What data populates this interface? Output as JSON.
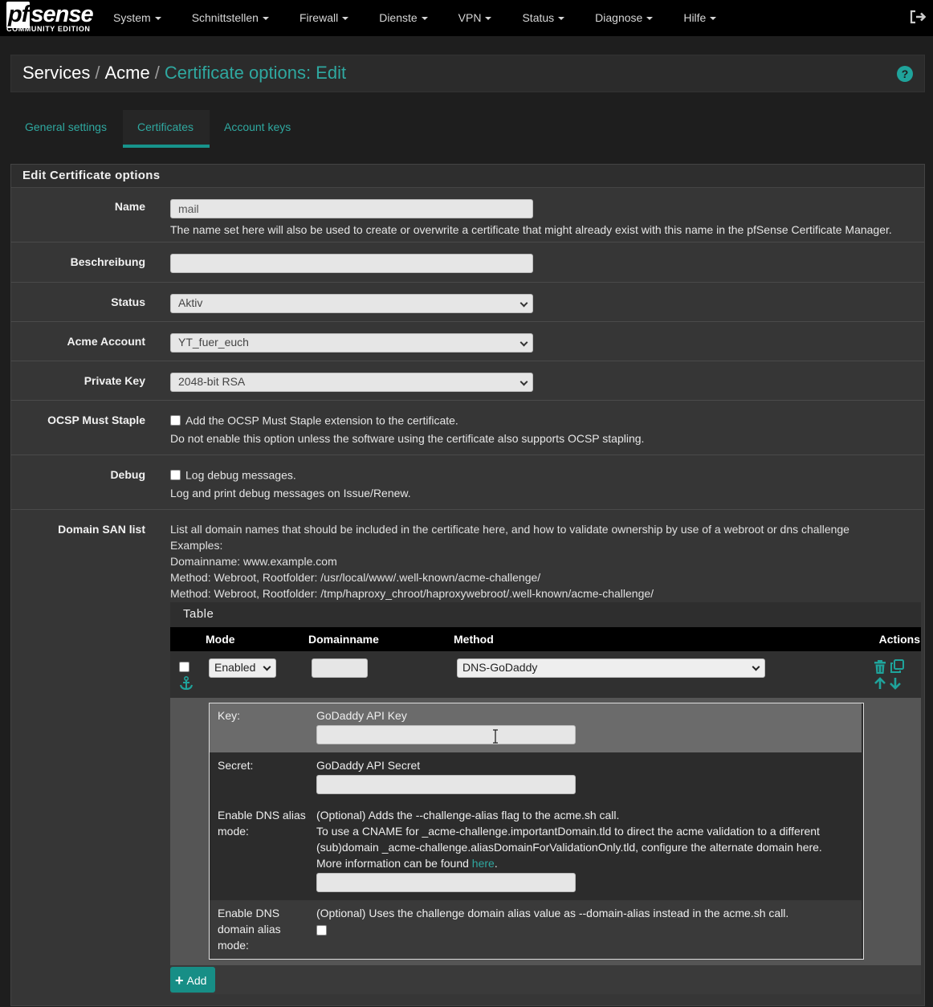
{
  "brand": {
    "logo_text": "pfsense",
    "edition": "COMMUNITY EDITION"
  },
  "nav": [
    {
      "label": "System"
    },
    {
      "label": "Schnittstellen"
    },
    {
      "label": "Firewall"
    },
    {
      "label": "Dienste"
    },
    {
      "label": "VPN"
    },
    {
      "label": "Status"
    },
    {
      "label": "Diagnose"
    },
    {
      "label": "Hilfe"
    }
  ],
  "breadcrumb": {
    "part1": "Services",
    "part2": "Acme",
    "current": "Certificate options: Edit",
    "separator": "/"
  },
  "tabs": [
    {
      "label": "General settings"
    },
    {
      "label": "Certificates"
    },
    {
      "label": "Account keys"
    }
  ],
  "panel": {
    "title": "Edit Certificate options"
  },
  "form": {
    "name": {
      "label": "Name",
      "value": "mail",
      "help": "The name set here will also be used to create or overwrite a certificate that might already exist with this name in the pfSense Certificate Manager."
    },
    "description": {
      "label": "Beschreibung",
      "value": ""
    },
    "status": {
      "label": "Status",
      "value": "Aktiv"
    },
    "account": {
      "label": "Acme Account",
      "value": "YT_fuer_euch"
    },
    "private_key": {
      "label": "Private Key",
      "value": "2048-bit RSA"
    },
    "ocsp": {
      "label": "OCSP Must Staple",
      "checkbox_text": "Add the OCSP Must Staple extension to the certificate.",
      "help": "Do not enable this option unless the software using the certificate also supports OCSP stapling."
    },
    "debug": {
      "label": "Debug",
      "checkbox_text": "Log debug messages.",
      "help": "Log and print debug messages on Issue/Renew."
    },
    "san": {
      "label": "Domain SAN list",
      "help_lines": [
        "List all domain names that should be included in the certificate here, and how to validate ownership by use of a webroot or dns challenge",
        "Examples:",
        "Domainname: www.example.com",
        "Method: Webroot, Rootfolder: /usr/local/www/.well-known/acme-challenge/",
        "Method: Webroot, Rootfolder: /tmp/haproxy_chroot/haproxywebroot/.well-known/acme-challenge/"
      ]
    }
  },
  "san_table": {
    "title": "Table",
    "headers": {
      "mode": "Mode",
      "domainname": "Domainname",
      "method": "Method",
      "actions": "Actions"
    },
    "row": {
      "mode": "Enabled",
      "domainname": "",
      "method": "DNS-GoDaddy"
    },
    "details": {
      "key_label": "Key:",
      "key_desc": "GoDaddy API Key",
      "secret_label": "Secret:",
      "secret_desc": "GoDaddy API Secret",
      "alias_label_1": "Enable DNS alias",
      "alias_label_2": "mode:",
      "alias_line1": "(Optional) Adds the --challenge-alias flag to the acme.sh call.",
      "alias_line2": "To use a CNAME for _acme-challenge.importantDomain.tld to direct the acme validation to a different",
      "alias_line3": "(sub)domain _acme-challenge.aliasDomainForValidationOnly.tld, configure the alternate domain here.",
      "alias_line4_prefix": "More information can be found ",
      "alias_line4_link": "here",
      "alias_line4_suffix": ".",
      "domain_alias_label_1": "Enable DNS",
      "domain_alias_label_2": "domain alias",
      "domain_alias_label_3": "mode:",
      "domain_alias_desc": "(Optional) Uses the challenge domain alias value as --domain-alias instead in the acme.sh call."
    },
    "add_label": "Add"
  },
  "colors": {
    "accent": "#2fa8a0",
    "button": "#178e86",
    "navbar": "#000000"
  }
}
